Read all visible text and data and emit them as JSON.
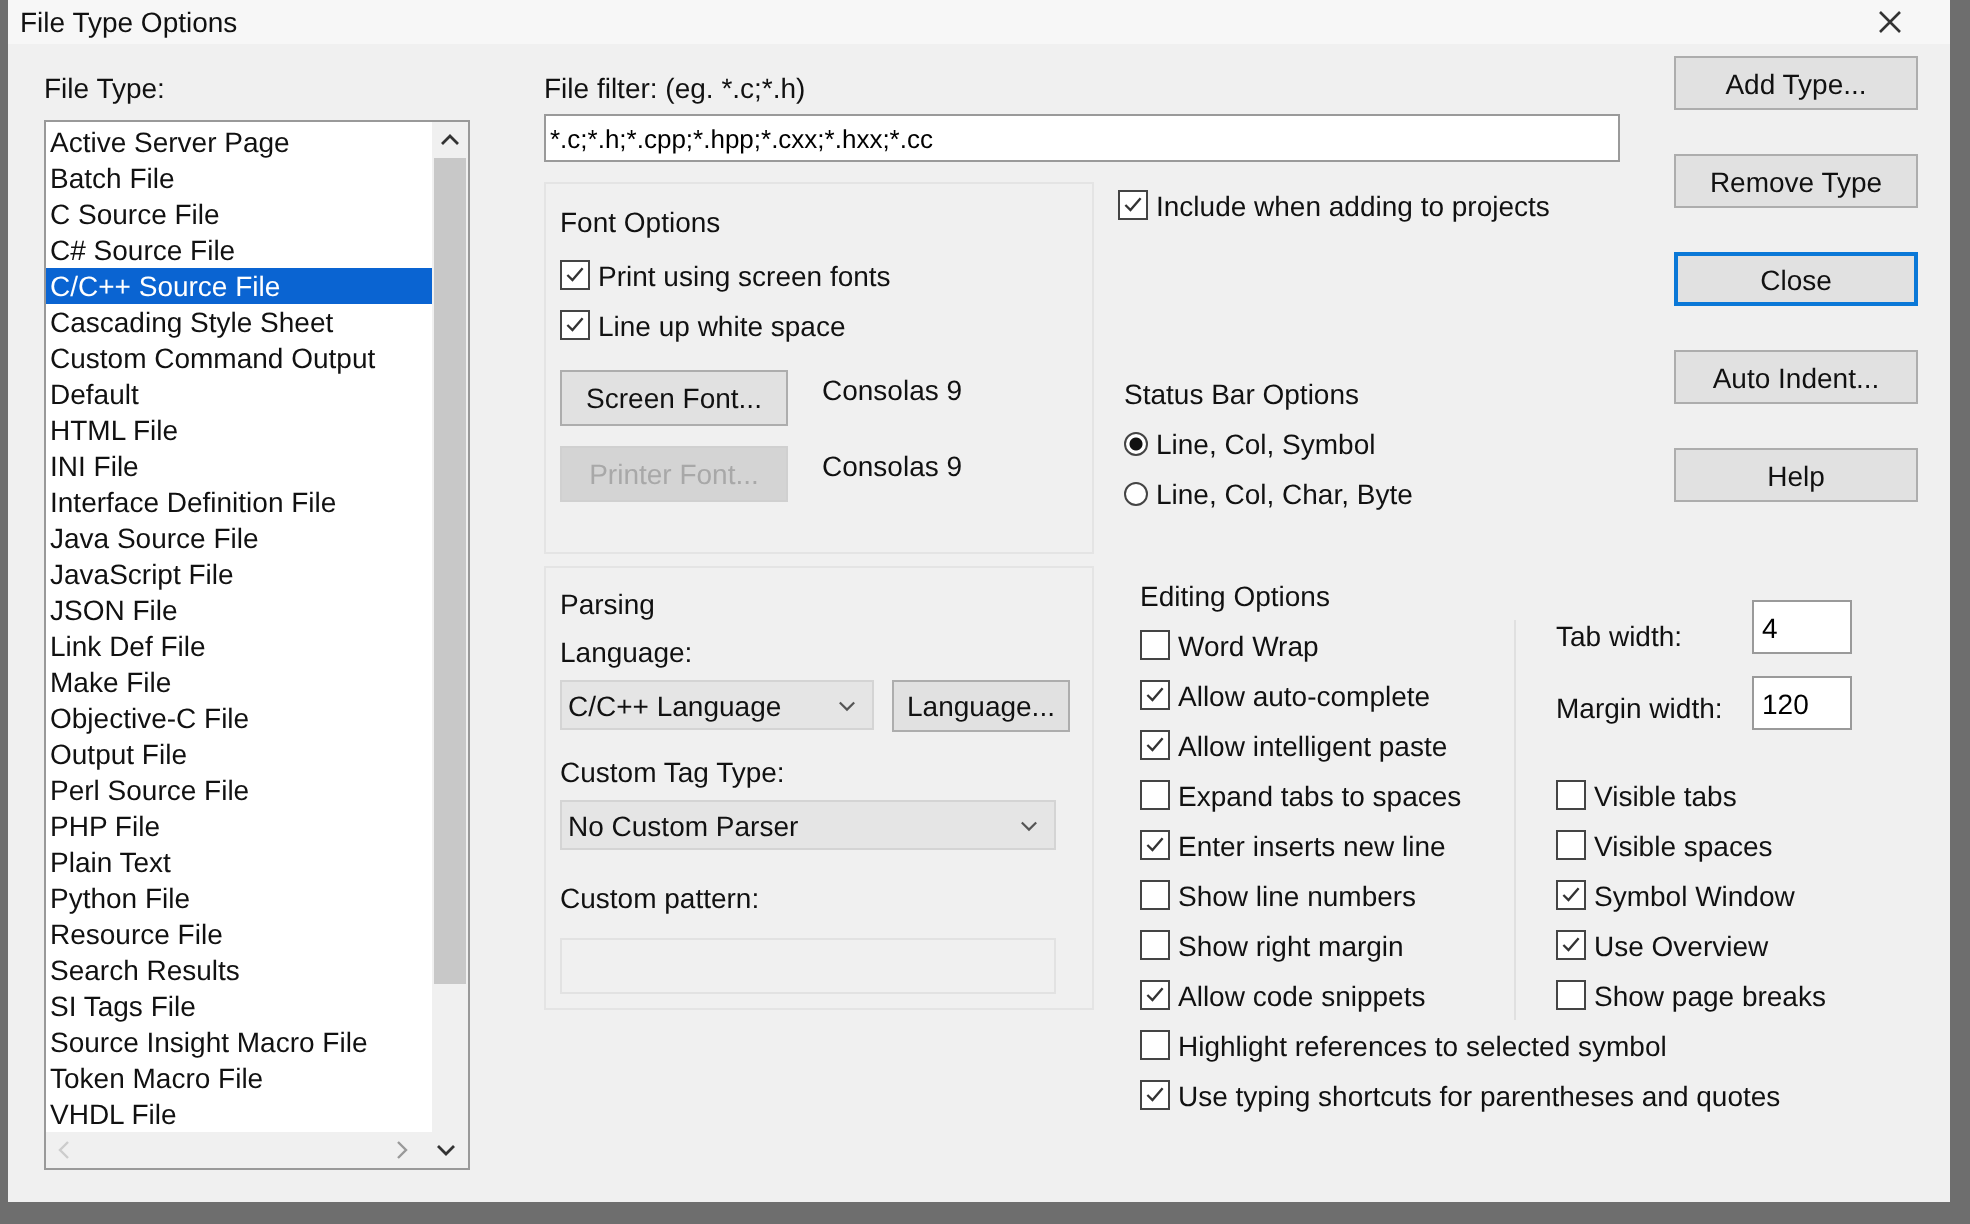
{
  "window": {
    "title": "File Type Options"
  },
  "file_type": {
    "label": "File Type:",
    "items": [
      {
        "label": "Active Server Page",
        "selected": false
      },
      {
        "label": "Batch File",
        "selected": false
      },
      {
        "label": "C Source File",
        "selected": false
      },
      {
        "label": "C# Source File",
        "selected": false
      },
      {
        "label": "C/C++ Source File",
        "selected": true
      },
      {
        "label": "Cascading Style Sheet",
        "selected": false
      },
      {
        "label": "Custom Command Output",
        "selected": false
      },
      {
        "label": "Default",
        "selected": false
      },
      {
        "label": "HTML File",
        "selected": false
      },
      {
        "label": "INI File",
        "selected": false
      },
      {
        "label": "Interface Definition File",
        "selected": false
      },
      {
        "label": "Java Source File",
        "selected": false
      },
      {
        "label": "JavaScript File",
        "selected": false
      },
      {
        "label": "JSON File",
        "selected": false
      },
      {
        "label": "Link Def File",
        "selected": false
      },
      {
        "label": "Make File",
        "selected": false
      },
      {
        "label": "Objective-C File",
        "selected": false
      },
      {
        "label": "Output File",
        "selected": false
      },
      {
        "label": "Perl Source File",
        "selected": false
      },
      {
        "label": "PHP File",
        "selected": false
      },
      {
        "label": "Plain Text",
        "selected": false
      },
      {
        "label": "Python File",
        "selected": false
      },
      {
        "label": "Resource File",
        "selected": false
      },
      {
        "label": "Search Results",
        "selected": false
      },
      {
        "label": "SI Tags File",
        "selected": false
      },
      {
        "label": "Source Insight Macro File",
        "selected": false
      },
      {
        "label": "Token Macro File",
        "selected": false
      },
      {
        "label": "VHDL File",
        "selected": false
      }
    ]
  },
  "file_filter": {
    "label": "File filter: (eg. *.c;*.h)",
    "value": "*.c;*.h;*.cpp;*.hpp;*.cxx;*.hxx;*.cc"
  },
  "buttons": [
    {
      "label": "Add Type...",
      "default": false
    },
    {
      "label": "Remove Type",
      "default": false
    },
    {
      "label": "Close",
      "default": true
    },
    {
      "label": "Auto Indent...",
      "default": false
    },
    {
      "label": "Help",
      "default": false
    }
  ],
  "font_options": {
    "title": "Font Options",
    "checkboxes": [
      {
        "label": "Print using screen fonts",
        "checked": true
      },
      {
        "label": "Line up white space",
        "checked": true
      }
    ],
    "fonts": [
      {
        "button": "Screen Font...",
        "disabled": false,
        "value": "Consolas 9"
      },
      {
        "button": "Printer Font...",
        "disabled": true,
        "value": "Consolas 9"
      }
    ]
  },
  "include_checkbox": {
    "label": "Include when adding to projects",
    "checked": true
  },
  "status_bar_options": {
    "title": "Status Bar Options",
    "options": [
      {
        "label": "Line, Col, Symbol",
        "selected": true
      },
      {
        "label": "Line, Col, Char, Byte",
        "selected": false
      }
    ]
  },
  "parsing": {
    "title": "Parsing",
    "language_label": "Language:",
    "language_value": "C/C++ Language",
    "language_button": "Language...",
    "tag_label": "Custom Tag Type:",
    "tag_value": "No Custom Parser",
    "pattern_label": "Custom pattern:"
  },
  "editing_options": {
    "title": "Editing Options",
    "left": [
      {
        "label": "Word Wrap",
        "checked": false
      },
      {
        "label": "Allow auto-complete",
        "checked": true
      },
      {
        "label": "Allow intelligent paste",
        "checked": true
      },
      {
        "label": "Expand tabs to spaces",
        "checked": false
      },
      {
        "label": "Enter inserts new line",
        "checked": true
      },
      {
        "label": "Show line numbers",
        "checked": false
      },
      {
        "label": "Show right margin",
        "checked": false
      },
      {
        "label": "Allow code snippets",
        "checked": true
      }
    ],
    "fields": [
      {
        "label": "Tab width:",
        "value": "4"
      },
      {
        "label": "Margin width:",
        "value": "120"
      }
    ],
    "right": [
      {
        "label": "Visible tabs",
        "checked": false
      },
      {
        "label": "Visible spaces",
        "checked": false
      },
      {
        "label": "Symbol Window",
        "checked": true
      },
      {
        "label": "Use Overview",
        "checked": true
      },
      {
        "label": "Show page breaks",
        "checked": false
      }
    ],
    "bottom": [
      {
        "label": "Highlight references to selected symbol",
        "checked": false
      },
      {
        "label": "Use typing shortcuts for parentheses and quotes",
        "checked": true
      }
    ]
  }
}
